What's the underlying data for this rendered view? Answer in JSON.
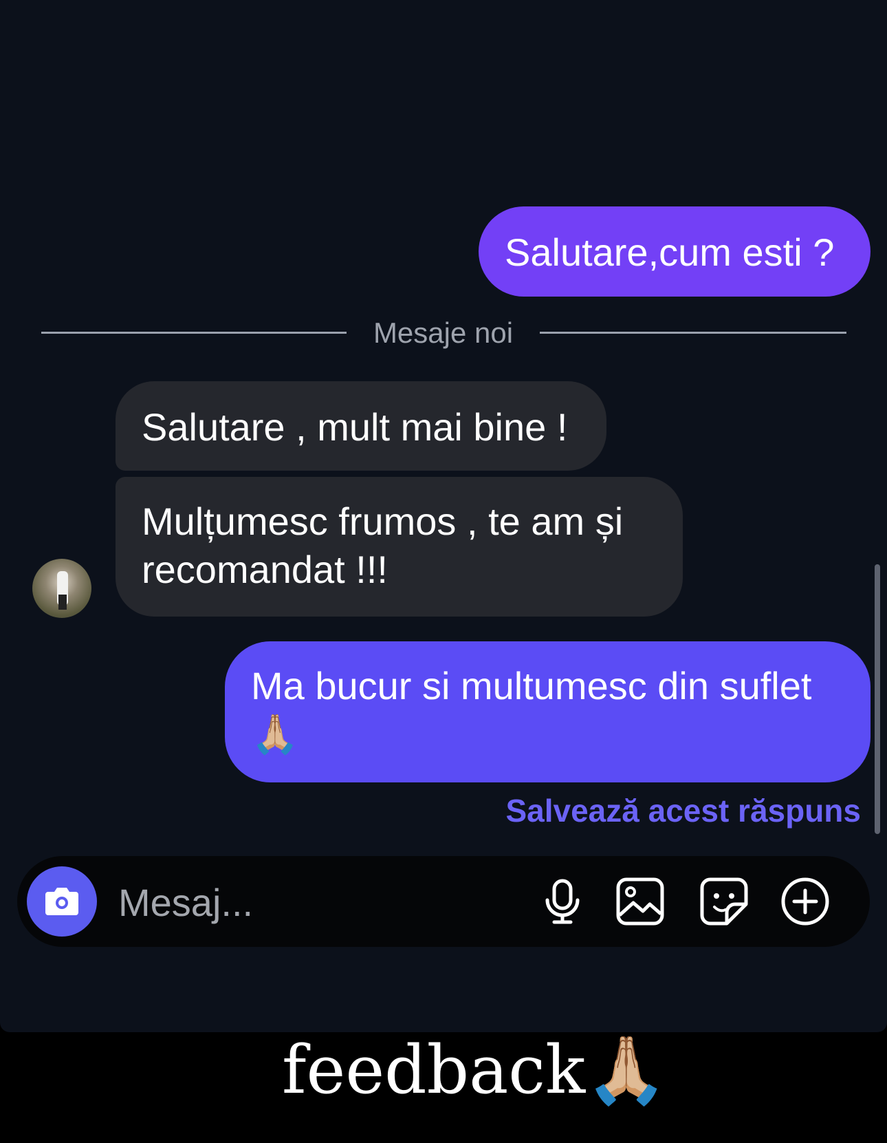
{
  "chat": {
    "messages": [
      {
        "direction": "outgoing",
        "text": "Salutare,cum esti ?"
      },
      {
        "direction": "incoming",
        "text": "Salutare , mult mai bine !"
      },
      {
        "direction": "incoming",
        "text": "Mulțumesc frumos , te am și recomandat !!!"
      },
      {
        "direction": "outgoing",
        "text": "Ma bucur si multumesc din suflet",
        "emoji": "🙏🏼"
      }
    ],
    "divider_label": "Mesaje noi",
    "save_reply_label": "Salvează acest răspuns"
  },
  "composer": {
    "placeholder": "Mesaj...",
    "icons": [
      "camera-icon",
      "microphone-icon",
      "gallery-icon",
      "sticker-icon",
      "plus-circle-icon"
    ]
  },
  "caption": {
    "text": "feedback",
    "emoji": "🙏🏼"
  },
  "colors": {
    "background": "#0c111b",
    "outgoing_bubble": "#6a46f2",
    "incoming_bubble": "#25272d",
    "accent": "#5b5cf0",
    "link": "#6b63f6"
  }
}
